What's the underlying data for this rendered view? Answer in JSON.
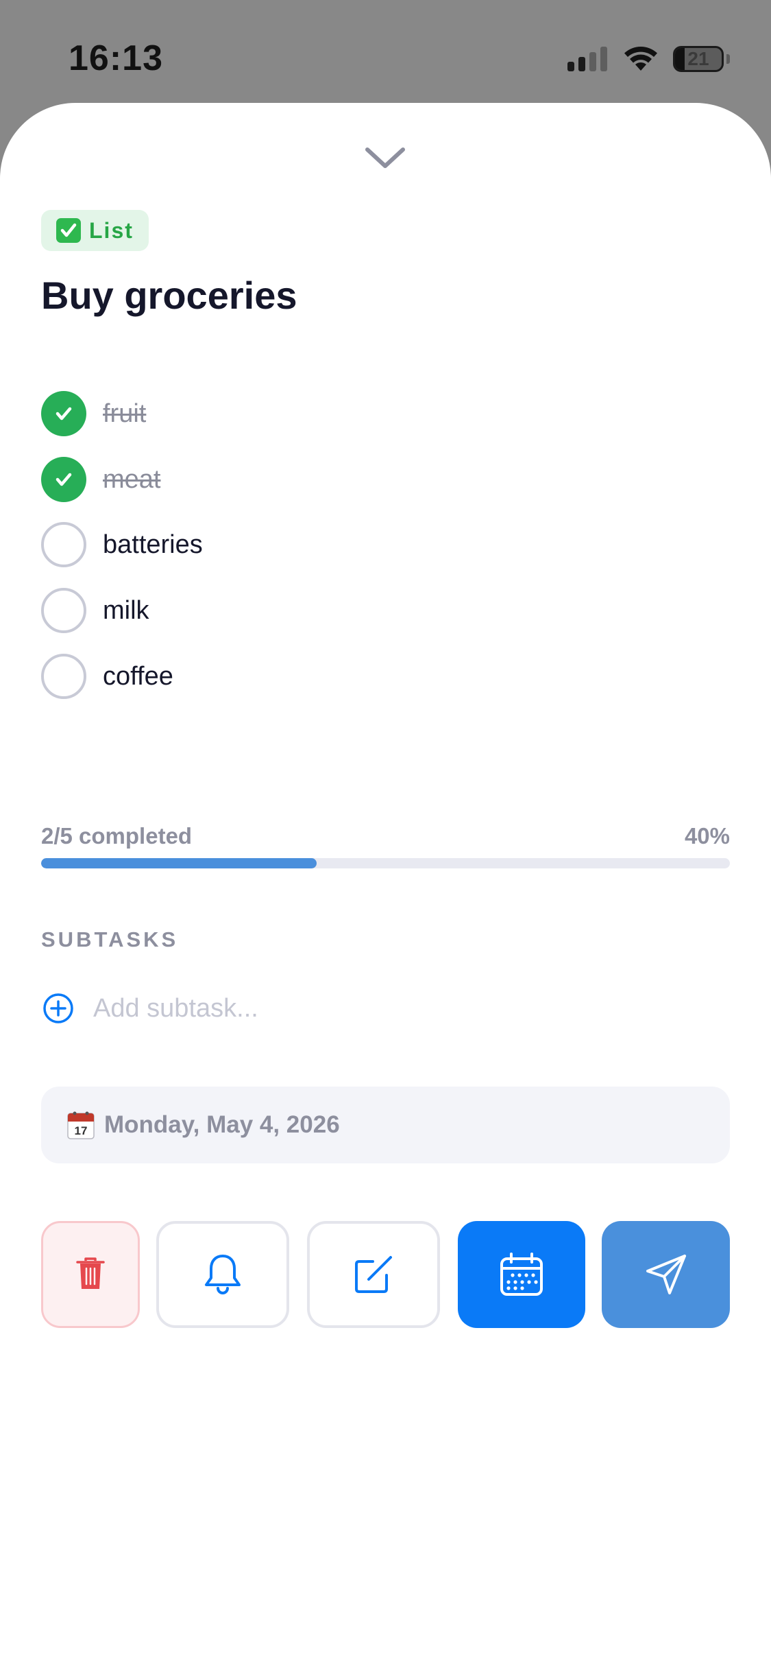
{
  "status_bar": {
    "time": "16:13",
    "battery_level": "21",
    "icons": [
      "signal-icon",
      "wifi-icon",
      "battery-icon"
    ]
  },
  "sheet": {
    "handle_icon": "chevron-down-icon",
    "tag": {
      "icon": "check-box-icon",
      "label": "List"
    },
    "title": "Buy groceries",
    "checklist": [
      {
        "text": "fruit",
        "checked": true
      },
      {
        "text": "meat",
        "checked": true
      },
      {
        "text": "batteries",
        "checked": false
      },
      {
        "text": "milk",
        "checked": false
      },
      {
        "text": "coffee",
        "checked": false
      }
    ],
    "progress": {
      "completed_text": "2/5 completed",
      "percent_text": "40%",
      "fraction": 0.4
    },
    "subtasks": {
      "header": "SUBTASKS",
      "add_icon": "plus-circle-icon",
      "placeholder": "Add subtask..."
    },
    "date": {
      "icon": "calendar-icon",
      "text": "Monday, May 4, 2026"
    },
    "actions": [
      {
        "name": "delete",
        "icon": "trash-icon"
      },
      {
        "name": "reminder",
        "icon": "bell-icon"
      },
      {
        "name": "edit",
        "icon": "edit-icon"
      },
      {
        "name": "calendar",
        "icon": "calendar-icon"
      },
      {
        "name": "send",
        "icon": "send-icon"
      }
    ]
  },
  "colors": {
    "accent": "#0a7af7",
    "success": "#27ae57",
    "danger": "#e5484d",
    "progress": "#4a8fdc"
  }
}
